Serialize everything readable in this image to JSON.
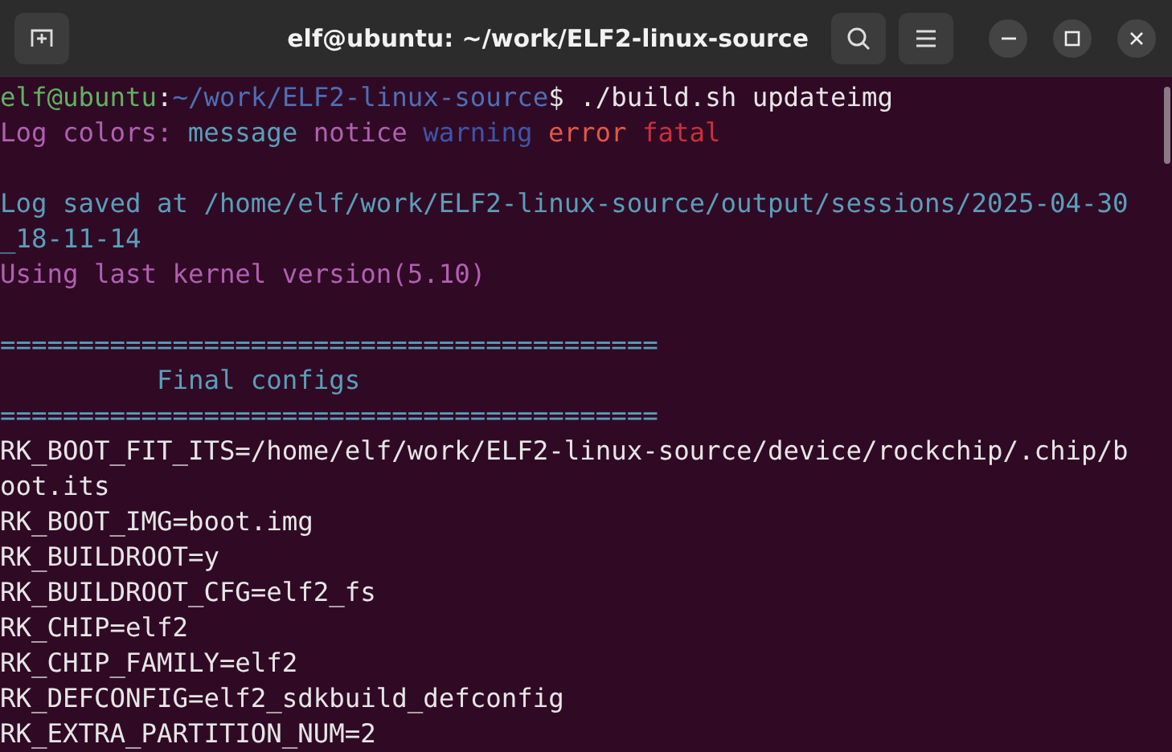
{
  "window": {
    "title": "elf@ubuntu: ~/work/ELF2-linux-source"
  },
  "terminal": {
    "lines": [
      {
        "kind": "text",
        "segments": [
          {
            "kind": "user",
            "text": "elf@ubuntu"
          },
          {
            "kind": "plain",
            "text": ":"
          },
          {
            "kind": "path",
            "text": "~/work/ELF2-linux-source"
          },
          {
            "kind": "plain",
            "text": "$ ./build.sh updateimg"
          }
        ]
      },
      {
        "kind": "text",
        "segments": [
          {
            "kind": "notice",
            "text": "Log colors:"
          },
          {
            "kind": "message",
            "text": "message"
          },
          {
            "kind": "notice",
            "text": "notice"
          },
          {
            "kind": "warning",
            "text": "warning"
          },
          {
            "kind": "error",
            "text": "error"
          },
          {
            "kind": "fatal",
            "text": "fatal"
          }
        ]
      },
      {
        "kind": "blank"
      },
      {
        "kind": "text",
        "segments": [
          {
            "kind": "message",
            "text": "Log saved at /home/elf/work/ELF2-linux-source/output/sessions/2025-04-30"
          }
        ]
      },
      {
        "kind": "text",
        "segments": [
          {
            "kind": "message",
            "text": "_18-11-14"
          }
        ]
      },
      {
        "kind": "text",
        "segments": [
          {
            "kind": "notice",
            "text": "Using last kernel version(5.10)"
          }
        ]
      },
      {
        "kind": "blank"
      },
      {
        "kind": "text",
        "segments": [
          {
            "kind": "message",
            "text": "=========================================="
          }
        ]
      },
      {
        "kind": "text",
        "segments": [
          {
            "kind": "message",
            "text": "          Final configs"
          }
        ]
      },
      {
        "kind": "text",
        "segments": [
          {
            "kind": "message",
            "text": "=========================================="
          }
        ]
      },
      {
        "kind": "text",
        "segments": [
          {
            "kind": "plain",
            "text": "RK_BOOT_FIT_ITS=/home/elf/work/ELF2-linux-source/device/rockchip/.chip/b"
          }
        ]
      },
      {
        "kind": "text",
        "segments": [
          {
            "kind": "plain",
            "text": "oot.its"
          }
        ]
      },
      {
        "kind": "text",
        "segments": [
          {
            "kind": "plain",
            "text": "RK_BOOT_IMG=boot.img"
          }
        ]
      },
      {
        "kind": "text",
        "segments": [
          {
            "kind": "plain",
            "text": "RK_BUILDROOT=y"
          }
        ]
      },
      {
        "kind": "text",
        "segments": [
          {
            "kind": "plain",
            "text": "RK_BUILDROOT_CFG=elf2_fs"
          }
        ]
      },
      {
        "kind": "text",
        "segments": [
          {
            "kind": "plain",
            "text": "RK_CHIP=elf2"
          }
        ]
      },
      {
        "kind": "text",
        "segments": [
          {
            "kind": "plain",
            "text": "RK_CHIP_FAMILY=elf2"
          }
        ]
      },
      {
        "kind": "text",
        "segments": [
          {
            "kind": "plain",
            "text": "RK_DEFCONFIG=elf2_sdkbuild_defconfig"
          }
        ]
      },
      {
        "kind": "text",
        "segments": [
          {
            "kind": "plain",
            "text": "RK_EXTRA_PARTITION_NUM=2"
          }
        ]
      }
    ]
  }
}
